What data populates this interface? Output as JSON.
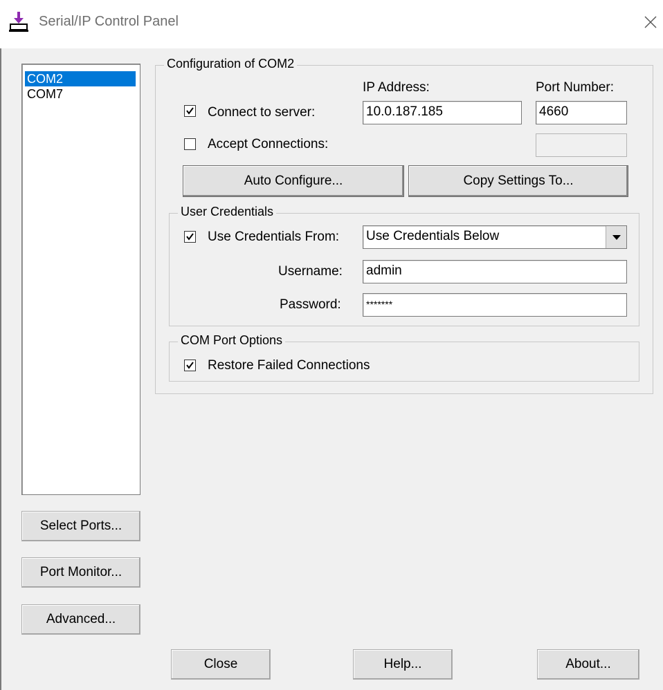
{
  "window": {
    "title": "Serial/IP Control Panel"
  },
  "port_list": {
    "items": [
      "COM2",
      "COM7"
    ],
    "selected_index": 0
  },
  "left_buttons": {
    "select_ports": "Select Ports...",
    "port_monitor": "Port Monitor...",
    "advanced": "Advanced..."
  },
  "config": {
    "legend": "Configuration of COM2",
    "ip_header": "IP Address:",
    "port_header": "Port Number:",
    "connect_label": "Connect to server:",
    "connect_checked": true,
    "ip_value": "10.0.187.185",
    "port_value": "4660",
    "accept_label": "Accept Connections:",
    "accept_checked": false,
    "accept_port_value": "",
    "auto_configure": "Auto Configure...",
    "copy_settings": "Copy Settings To..."
  },
  "credentials": {
    "legend": "User Credentials",
    "use_from_label": "Use Credentials From:",
    "use_from_checked": true,
    "use_from_value": "Use Credentials Below",
    "username_label": "Username:",
    "username_value": "admin",
    "password_label": "Password:",
    "password_value": "*******"
  },
  "com_options": {
    "legend": "COM Port Options",
    "restore_label": "Restore Failed Connections",
    "restore_checked": true
  },
  "bottom_buttons": {
    "close": "Close",
    "help": "Help...",
    "about": "About..."
  },
  "colors": {
    "selection": "#0078d7",
    "icon_purple": "#8e2bb0"
  }
}
